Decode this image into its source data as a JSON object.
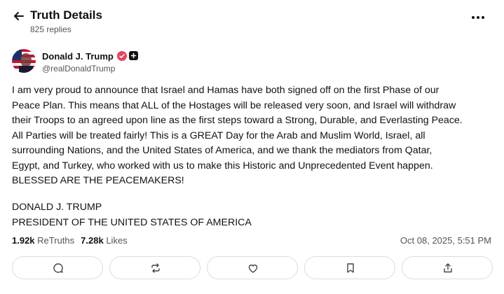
{
  "header": {
    "back_icon": "arrow-left-icon",
    "title": "Truth Details",
    "subtitle": "825 replies",
    "more_icon": "more-horizontal-icon"
  },
  "author": {
    "name": "Donald J. Trump",
    "handle": "@realDonaldTrump",
    "verified_color": "#e8445a"
  },
  "post": {
    "lines": [
      "I am very proud to announce that Israel and Hamas have both signed off on the first Phase of our",
      "Peace Plan. This means that ALL of the Hostages will be released very soon, and Israel will withdraw",
      "their Troops to an agreed upon line as the first steps toward a Strong, Durable, and Everlasting Peace.",
      "All Parties will be treated fairly! This is a GREAT Day for the Arab and Muslim World, Israel, all",
      "surrounding Nations, and the United States of America, and we thank the mediators from Qatar,",
      "Egypt, and Turkey, who worked with us to make this Historic and Unprecedented Event happen.",
      "BLESSED ARE THE PEACEMAKERS!"
    ],
    "signature": [
      "DONALD J. TRUMP",
      "PRESIDENT OF THE UNITED STATES OF AMERICA"
    ]
  },
  "stats": {
    "retruths_count": "1.92k",
    "retruths_label": "ReTruths",
    "likes_count": "7.28k",
    "likes_label": "Likes",
    "timestamp": "Oct 08, 2025, 5:51 PM"
  },
  "actions": [
    {
      "icon": "reply-icon"
    },
    {
      "icon": "retruth-icon"
    },
    {
      "icon": "like-icon"
    },
    {
      "icon": "bookmark-icon"
    },
    {
      "icon": "share-icon"
    }
  ]
}
